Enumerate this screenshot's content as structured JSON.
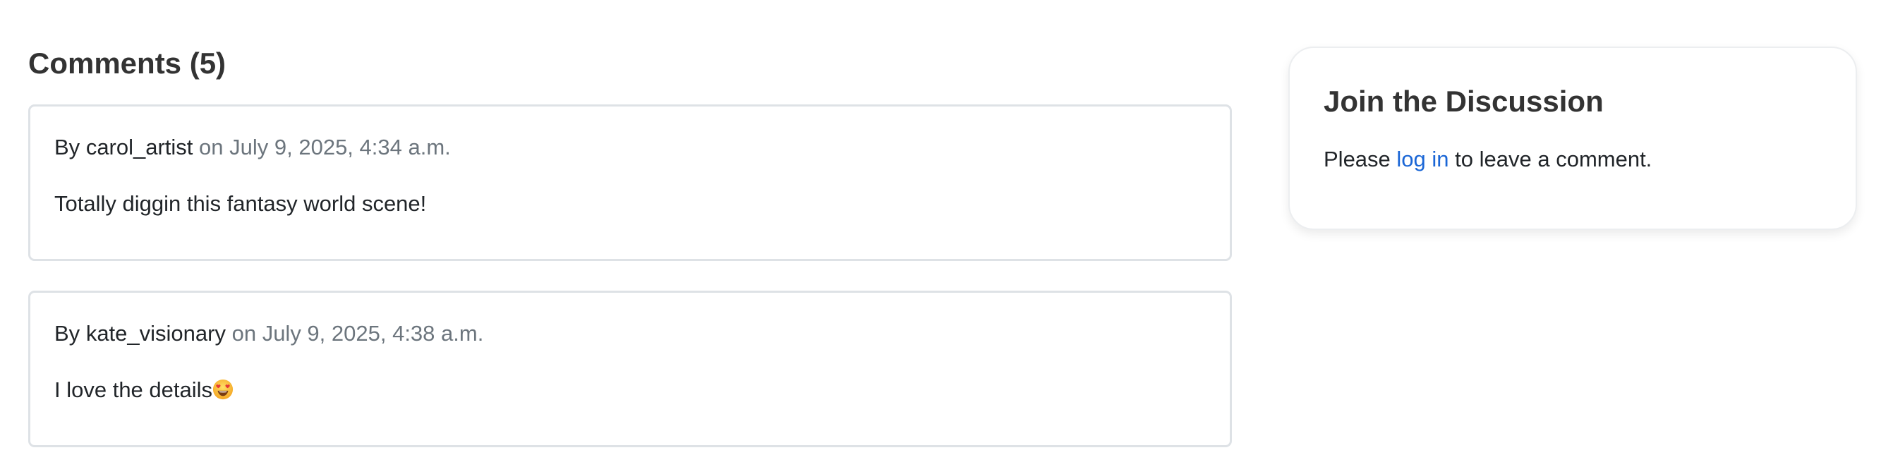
{
  "comments_section": {
    "title": "Comments (5)",
    "comments": [
      {
        "prefix": "By",
        "author": "carol_artist",
        "date": "on July 9, 2025, 4:34 a.m.",
        "body": "Totally diggin this fantasy world scene!"
      },
      {
        "prefix": "By",
        "author": "kate_visionary",
        "date": "on July 9, 2025, 4:38 a.m.",
        "body": "I love the details",
        "emoji": "smiling-face-with-heart-eyes-icon"
      }
    ]
  },
  "discussion_card": {
    "title": "Join the Discussion",
    "text_before": "Please",
    "link_label": "log in",
    "text_after": "to leave a comment."
  },
  "colors": {
    "link": "#1a66d6",
    "muted_date": "#6c757d",
    "card_border": "#dee2e6"
  }
}
